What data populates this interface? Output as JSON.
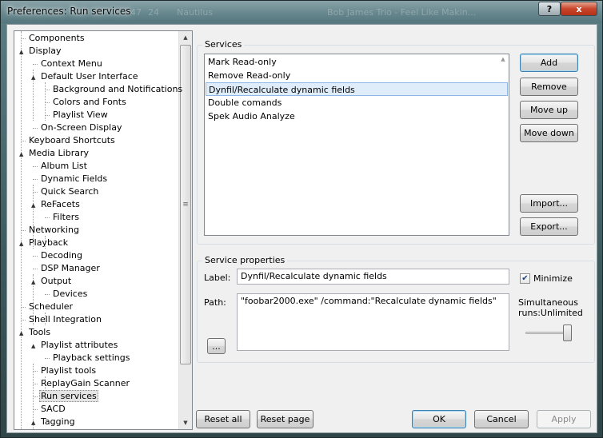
{
  "window": {
    "title": "Preferences: Run services",
    "background_title_fragments": [
      "47",
      "24",
      "Nautilus",
      "Bob James Trio - Feel Like Makin..."
    ],
    "help_label": "?",
    "close_label": "x"
  },
  "tree": {
    "items": [
      {
        "label": "Components",
        "level": 0,
        "expander": ""
      },
      {
        "label": "Display",
        "level": 0,
        "expander": "▲"
      },
      {
        "label": "Context Menu",
        "level": 1,
        "expander": ""
      },
      {
        "label": "Default User Interface",
        "level": 1,
        "expander": "▲"
      },
      {
        "label": "Background and Notifications",
        "level": 2,
        "expander": ""
      },
      {
        "label": "Colors and Fonts",
        "level": 2,
        "expander": ""
      },
      {
        "label": "Playlist View",
        "level": 2,
        "expander": ""
      },
      {
        "label": "On-Screen Display",
        "level": 1,
        "expander": ""
      },
      {
        "label": "Keyboard Shortcuts",
        "level": 0,
        "expander": ""
      },
      {
        "label": "Media Library",
        "level": 0,
        "expander": "▲"
      },
      {
        "label": "Album List",
        "level": 1,
        "expander": ""
      },
      {
        "label": "Dynamic Fields",
        "level": 1,
        "expander": ""
      },
      {
        "label": "Quick Search",
        "level": 1,
        "expander": ""
      },
      {
        "label": "ReFacets",
        "level": 1,
        "expander": "▲"
      },
      {
        "label": "Filters",
        "level": 2,
        "expander": ""
      },
      {
        "label": "Networking",
        "level": 0,
        "expander": ""
      },
      {
        "label": "Playback",
        "level": 0,
        "expander": "▲"
      },
      {
        "label": "Decoding",
        "level": 1,
        "expander": ""
      },
      {
        "label": "DSP Manager",
        "level": 1,
        "expander": ""
      },
      {
        "label": "Output",
        "level": 1,
        "expander": "▲"
      },
      {
        "label": "Devices",
        "level": 2,
        "expander": ""
      },
      {
        "label": "Scheduler",
        "level": 0,
        "expander": ""
      },
      {
        "label": "Shell Integration",
        "level": 0,
        "expander": ""
      },
      {
        "label": "Tools",
        "level": 0,
        "expander": "▲"
      },
      {
        "label": "Playlist attributes",
        "level": 1,
        "expander": "▲"
      },
      {
        "label": "Playback settings",
        "level": 2,
        "expander": ""
      },
      {
        "label": "Playlist tools",
        "level": 1,
        "expander": ""
      },
      {
        "label": "ReplayGain Scanner",
        "level": 1,
        "expander": ""
      },
      {
        "label": "Run services",
        "level": 1,
        "expander": "",
        "selected": true
      },
      {
        "label": "SACD",
        "level": 1,
        "expander": ""
      },
      {
        "label": "Tagging",
        "level": 1,
        "expander": "▲"
      }
    ],
    "scroll_up": "▲",
    "scroll_down": "▼",
    "thumb_grip": "≡"
  },
  "services": {
    "legend": "Services",
    "items": [
      "Mark Read-only",
      "Remove Read-only",
      "Dynfil/Recalculate dynamic fields",
      "Double comands",
      "Spek Audio Analyze"
    ],
    "selected_index": 2,
    "buttons": {
      "add": "Add",
      "remove": "Remove",
      "move_up": "Move up",
      "move_down": "Move down",
      "import": "Import...",
      "export": "Export..."
    }
  },
  "properties": {
    "legend": "Service properties",
    "label_caption": "Label:",
    "label_value": "Dynfil/Recalculate dynamic fields",
    "path_caption": "Path:",
    "path_value": "\"foobar2000.exe\" /command:\"Recalculate dynamic fields\"",
    "browse_label": "...",
    "minimize_label": "Minimize",
    "minimize_checked": "✔",
    "simultaneous_label": "Simultaneous",
    "runs_label": "runs:Unlimited"
  },
  "footer": {
    "reset_all": "Reset all",
    "reset_page": "Reset page",
    "ok": "OK",
    "cancel": "Cancel",
    "apply": "Apply"
  }
}
